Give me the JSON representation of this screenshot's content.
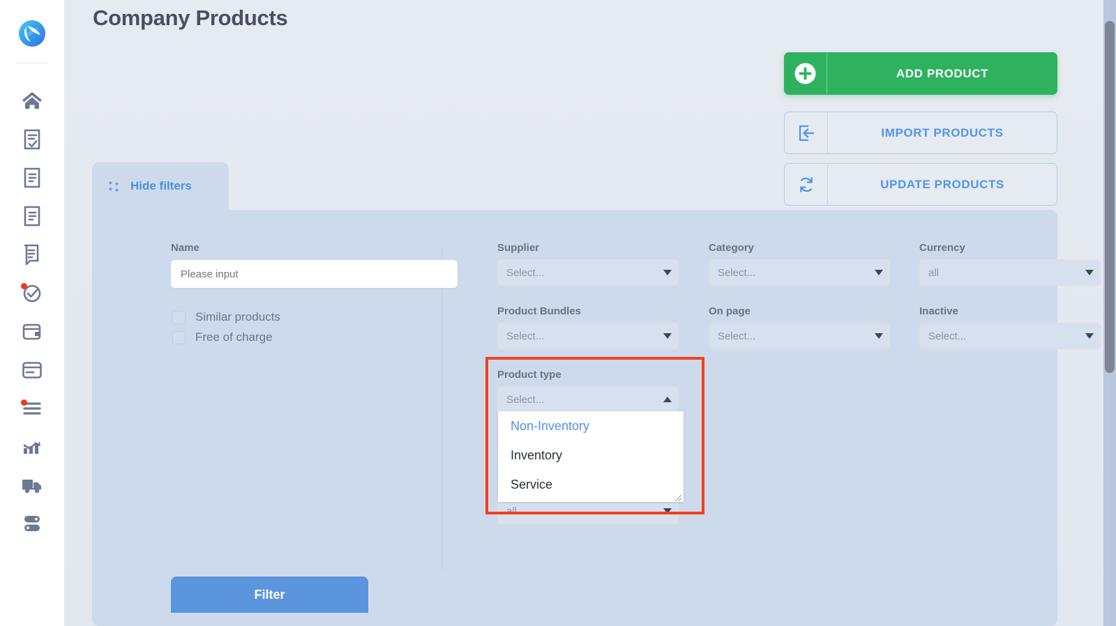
{
  "page": {
    "title": "Company Products"
  },
  "sidebar": {
    "logo_name": "app-logo",
    "items": [
      {
        "icon": "home-icon",
        "badge": false
      },
      {
        "icon": "document-check-icon",
        "badge": false
      },
      {
        "icon": "document-lines-icon",
        "badge": false
      },
      {
        "icon": "document-lines-icon",
        "badge": false
      },
      {
        "icon": "document-scroll-icon",
        "badge": false
      },
      {
        "icon": "check-circle-icon",
        "badge": true
      },
      {
        "icon": "wallet-icon",
        "badge": false
      },
      {
        "icon": "credit-card-icon",
        "badge": false
      },
      {
        "icon": "list-lines-icon",
        "badge": true
      },
      {
        "icon": "bar-chart-growth-icon",
        "badge": false
      },
      {
        "icon": "truck-delivery-icon",
        "badge": false
      },
      {
        "icon": "server-stack-icon",
        "badge": false
      }
    ]
  },
  "actions": {
    "add_product": {
      "label": "ADD PRODUCT",
      "icon": "plus-circle-icon",
      "color": "#2eb25f"
    },
    "import_products": {
      "label": "IMPORT PRODUCTS",
      "icon": "import-arrow-icon",
      "color": "#5096e8"
    },
    "update_products": {
      "label": "UPDATE PRODUCTS",
      "icon": "refresh-sync-icon",
      "color": "#5096e8"
    }
  },
  "filters": {
    "tab_label": "Hide filters",
    "tab_icon": "dots-filter-icon",
    "submit_label": "Filter",
    "name": {
      "label": "Name",
      "value": "",
      "placeholder": "Please input"
    },
    "checkboxes": [
      {
        "label": "Similar products",
        "checked": false
      },
      {
        "label": "Free of charge",
        "checked": false
      }
    ],
    "selects": [
      {
        "label": "Supplier",
        "value": "Select...",
        "open": false
      },
      {
        "label": "Category",
        "value": "Select...",
        "open": false
      },
      {
        "label": "Currency",
        "value": "all",
        "open": false
      },
      {
        "label": "Product Bundles",
        "value": "Select...",
        "open": false
      },
      {
        "label": "On page",
        "value": "Select...",
        "open": false
      },
      {
        "label": "Inactive",
        "value": "Select...",
        "open": false
      },
      {
        "label": "Product type",
        "value": "Select...",
        "open": true
      },
      {
        "label": "",
        "value": "all",
        "open": false
      }
    ],
    "product_type_options": [
      {
        "label": "Non-Inventory",
        "highlighted": true
      },
      {
        "label": "Inventory",
        "highlighted": false
      },
      {
        "label": "Service",
        "highlighted": false
      }
    ],
    "highlight_color": "#f4401c"
  }
}
